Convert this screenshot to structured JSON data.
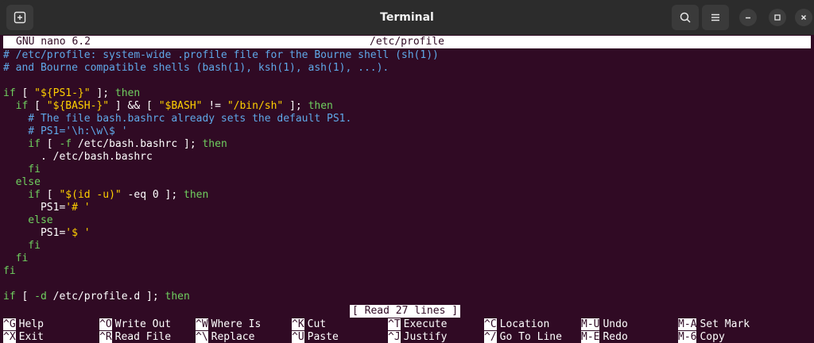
{
  "window": {
    "title": "Terminal"
  },
  "nano": {
    "version": "GNU nano 6.2",
    "filename": "/etc/profile",
    "status": "[ Read 27 lines ]"
  },
  "lines": [
    [
      {
        "t": "# /etc/profile: system-wide .profile file for the Bourne shell (sh(1))",
        "c": "com"
      }
    ],
    [
      {
        "t": "# and Bourne compatible shells (bash(1), ksh(1), ash(1), ...).",
        "c": "com"
      }
    ],
    [],
    [
      {
        "t": "if",
        "c": "kw"
      },
      {
        "t": " [ ",
        "c": "pl"
      },
      {
        "t": "\"${PS1-}\"",
        "c": "str"
      },
      {
        "t": " ]; ",
        "c": "pl"
      },
      {
        "t": "then",
        "c": "kw"
      }
    ],
    [
      {
        "t": "  if",
        "c": "kw"
      },
      {
        "t": " [ ",
        "c": "pl"
      },
      {
        "t": "\"${BASH-}\"",
        "c": "str"
      },
      {
        "t": " ] && [ ",
        "c": "pl"
      },
      {
        "t": "\"$BASH\"",
        "c": "str"
      },
      {
        "t": " != ",
        "c": "pl"
      },
      {
        "t": "\"/bin/sh\"",
        "c": "str"
      },
      {
        "t": " ]; ",
        "c": "pl"
      },
      {
        "t": "then",
        "c": "kw"
      }
    ],
    [
      {
        "t": "    # The file bash.bashrc already sets the default PS1.",
        "c": "com"
      }
    ],
    [
      {
        "t": "    # PS1='\\h:\\w\\$ '",
        "c": "com"
      }
    ],
    [
      {
        "t": "    if",
        "c": "kw"
      },
      {
        "t": " [ ",
        "c": "pl"
      },
      {
        "t": "-f",
        "c": "kw"
      },
      {
        "t": " /etc/bash.bashrc ]; ",
        "c": "pl"
      },
      {
        "t": "then",
        "c": "kw"
      }
    ],
    [
      {
        "t": "      . /etc/bash.bashrc",
        "c": "pl"
      }
    ],
    [
      {
        "t": "    fi",
        "c": "kw"
      }
    ],
    [
      {
        "t": "  else",
        "c": "kw"
      }
    ],
    [
      {
        "t": "    if",
        "c": "kw"
      },
      {
        "t": " [ ",
        "c": "pl"
      },
      {
        "t": "\"$(id -u)\"",
        "c": "str"
      },
      {
        "t": " -eq 0 ]; ",
        "c": "pl"
      },
      {
        "t": "then",
        "c": "kw"
      }
    ],
    [
      {
        "t": "      PS1=",
        "c": "pl"
      },
      {
        "t": "'# '",
        "c": "str"
      }
    ],
    [
      {
        "t": "    else",
        "c": "kw"
      }
    ],
    [
      {
        "t": "      PS1=",
        "c": "pl"
      },
      {
        "t": "'$ '",
        "c": "str"
      }
    ],
    [
      {
        "t": "    fi",
        "c": "kw"
      }
    ],
    [
      {
        "t": "  fi",
        "c": "kw"
      }
    ],
    [
      {
        "t": "fi",
        "c": "kw"
      }
    ],
    [],
    [
      {
        "t": "if",
        "c": "kw"
      },
      {
        "t": " [ ",
        "c": "pl"
      },
      {
        "t": "-d",
        "c": "kw"
      },
      {
        "t": " /etc/profile.d ]; ",
        "c": "pl"
      },
      {
        "t": "then",
        "c": "kw"
      }
    ]
  ],
  "shortcuts": [
    [
      {
        "key": "^G",
        "label": "Help"
      },
      {
        "key": "^O",
        "label": "Write Out"
      },
      {
        "key": "^W",
        "label": "Where Is"
      },
      {
        "key": "^K",
        "label": "Cut"
      },
      {
        "key": "^T",
        "label": "Execute"
      },
      {
        "key": "^C",
        "label": "Location"
      },
      {
        "key": "M-U",
        "label": "Undo"
      },
      {
        "key": "M-A",
        "label": "Set Mark"
      }
    ],
    [
      {
        "key": "^X",
        "label": "Exit"
      },
      {
        "key": "^R",
        "label": "Read File"
      },
      {
        "key": "^\\",
        "label": "Replace"
      },
      {
        "key": "^U",
        "label": "Paste"
      },
      {
        "key": "^J",
        "label": "Justify"
      },
      {
        "key": "^/",
        "label": "Go To Line"
      },
      {
        "key": "M-E",
        "label": "Redo"
      },
      {
        "key": "M-6",
        "label": "Copy"
      }
    ]
  ],
  "colors": {
    "terminal_bg": "#300a24",
    "comment": "#5fa8e8",
    "keyword": "#6fcf5f",
    "string": "#ffd000",
    "titlebar_bg": "#2c2c2c"
  }
}
